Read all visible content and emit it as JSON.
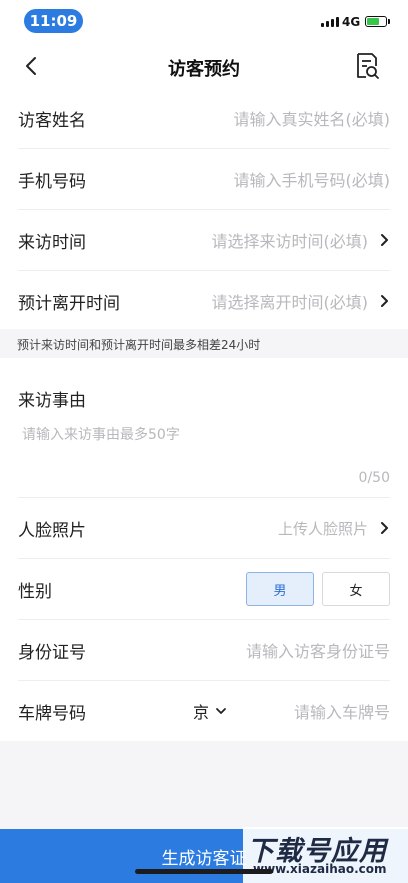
{
  "status_bar": {
    "time": "11:09",
    "network": "4G"
  },
  "nav": {
    "title": "访客预约",
    "back_icon": "chevron-left-icon",
    "record_icon": "document-search-icon"
  },
  "form": {
    "name": {
      "label": "访客姓名",
      "placeholder": "请输入真实姓名(必填)"
    },
    "phone": {
      "label": "手机号码",
      "placeholder": "请输入手机号码(必填)"
    },
    "visit_time": {
      "label": "来访时间",
      "placeholder": "请选择来访时间(必填)"
    },
    "leave_time": {
      "label": "预计离开时间",
      "placeholder": "请选择离开时间(必填)"
    }
  },
  "hint": "预计来访时间和预计离开时间最多相差24小时",
  "reason": {
    "label": "来访事由",
    "placeholder": "请输入来访事由最多50字",
    "counter": "0/50"
  },
  "form2": {
    "face": {
      "label": "人脸照片",
      "placeholder": "上传人脸照片"
    },
    "gender": {
      "label": "性别",
      "options": [
        "男",
        "女"
      ],
      "selected": "男"
    },
    "id_number": {
      "label": "身份证号",
      "placeholder": "请输入访客身份证号"
    },
    "plate": {
      "label": "车牌号码",
      "province": "京",
      "placeholder": "请输入车牌号"
    }
  },
  "submit": {
    "label": "生成访客证"
  },
  "watermark": {
    "title": "下载号应用",
    "url": "www.xiazaihao.com"
  },
  "colors": {
    "accent": "#2b7be0",
    "battery": "#37c64b"
  }
}
